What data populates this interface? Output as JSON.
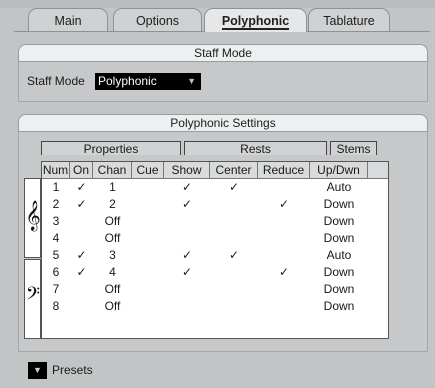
{
  "tabs": [
    {
      "label": "Main"
    },
    {
      "label": "Options"
    },
    {
      "label": "Polyphonic"
    },
    {
      "label": "Tablature"
    }
  ],
  "active_tab": "Polyphonic",
  "staff_mode": {
    "section_title": "Staff Mode",
    "label": "Staff Mode",
    "value": "Polyphonic"
  },
  "polyphonic": {
    "section_title": "Polyphonic Settings",
    "groups": {
      "properties": "Properties",
      "rests": "Rests",
      "stems": "Stems"
    },
    "columns": [
      "Num",
      "On",
      "Chan",
      "Cue",
      "Show",
      "Center",
      "Reduce",
      "Up/Dwn"
    ],
    "rows": [
      [
        "1",
        "✓",
        "1",
        "",
        "✓",
        "✓",
        "",
        "Auto"
      ],
      [
        "2",
        "✓",
        "2",
        "",
        "✓",
        "",
        "✓",
        "Down"
      ],
      [
        "3",
        "",
        "Off",
        "",
        "",
        "",
        "",
        "Down"
      ],
      [
        "4",
        "",
        "Off",
        "",
        "",
        "",
        "",
        "Down"
      ],
      [
        "5",
        "✓",
        "3",
        "",
        "✓",
        "✓",
        "",
        "Auto"
      ],
      [
        "6",
        "✓",
        "4",
        "",
        "✓",
        "",
        "✓",
        "Down"
      ],
      [
        "7",
        "",
        "Off",
        "",
        "",
        "",
        "",
        "Down"
      ],
      [
        "8",
        "",
        "Off",
        "",
        "",
        "",
        "",
        "Down"
      ]
    ],
    "clefs": {
      "upper": "treble-clef-icon",
      "lower": "bass-clef-icon"
    }
  },
  "presets": {
    "label": "Presets",
    "icon": "dropdown-arrow-icon"
  }
}
